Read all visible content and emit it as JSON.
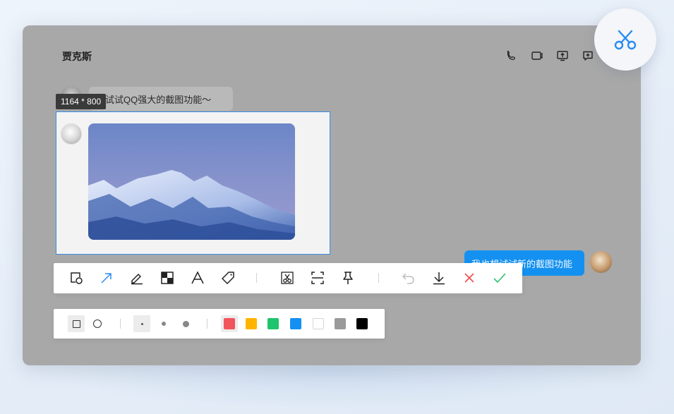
{
  "chat": {
    "title": "贾克斯",
    "incoming_message": "来试试QQ强大的截图功能～",
    "outgoing_message": "我也想试试新的截图功能"
  },
  "screenshot": {
    "size_label": "1164 * 800"
  },
  "header_icons": [
    "phone-icon",
    "video-icon",
    "screen-share-icon",
    "add-chat-icon"
  ],
  "toolbar": {
    "tools": [
      "rectangle-tool",
      "arrow-tool",
      "pen-tool",
      "mosaic-tool",
      "text-tool",
      "tag-tool",
      "screenshot-capture",
      "scan-tool",
      "pin-tool",
      "undo",
      "download",
      "cancel",
      "confirm"
    ]
  },
  "sub_toolbar": {
    "shapes": [
      "square",
      "circle"
    ],
    "sizes": [
      "small",
      "medium",
      "large"
    ],
    "colors": [
      "#f2545b",
      "#ffb400",
      "#1fc46e",
      "#1490f2",
      "#ffffff",
      "#9a9a9a",
      "#000000"
    ]
  },
  "colors": {
    "accent": "#1491f0",
    "scissor": "#2a8cf0",
    "cancel": "#f04d4d",
    "confirm": "#2fbf71"
  }
}
